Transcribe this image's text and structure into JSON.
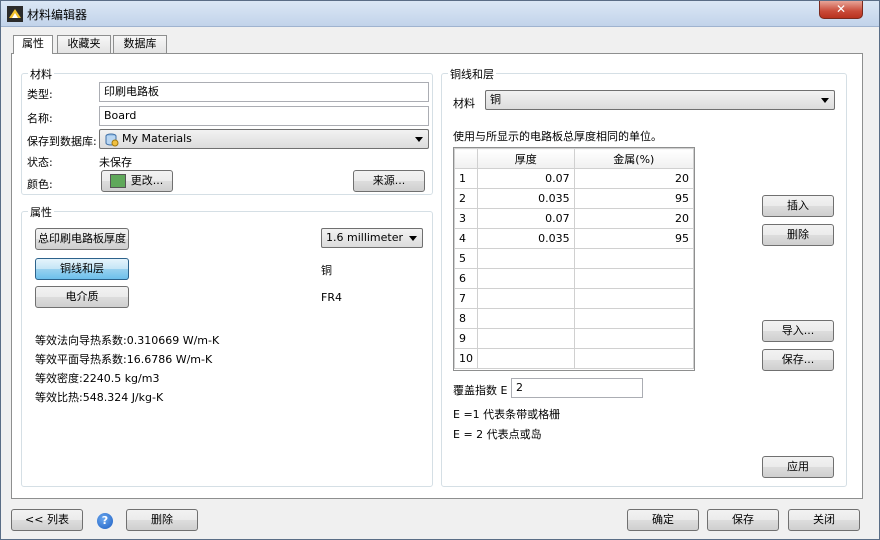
{
  "window": {
    "title": "材料编辑器",
    "close_label": "✕"
  },
  "tabs": [
    {
      "label": "属性",
      "active": true
    },
    {
      "label": "收藏夹",
      "active": false
    },
    {
      "label": "数据库",
      "active": false
    }
  ],
  "material": {
    "group_title": "材料",
    "type_label": "类型:",
    "type_value": "印刷电路板",
    "name_label": "名称:",
    "name_value": "Board",
    "save_label": "保存到数据库:",
    "save_value": "My Materials",
    "state_label": "状态:",
    "state_value": "未保存",
    "color_label": "颜色:",
    "color_swatch": "#5fa85a",
    "change_button": "更改...",
    "source_button": "来源..."
  },
  "properties": {
    "group_title": "属性",
    "thickness_button": "总印刷电路板厚度",
    "thickness_value": "1.6 millimeter",
    "copper_button": "铜线和层",
    "copper_value": "铜",
    "dielectric_button": "电介质",
    "dielectric_value": "FR4",
    "stats": [
      "等效法向导热系数:0.310669 W/m-K",
      "等效平面导热系数:16.6786 W/m-K",
      "等效密度:2240.5 kg/m3",
      "等效比热:548.324 J/kg-K"
    ]
  },
  "copper": {
    "group_title": "铜线和层",
    "material_label": "材料",
    "material_value": "铜",
    "hint": "使用与所显示的电路板总厚度相同的单位。",
    "columns": [
      "厚度",
      "金属(%)"
    ],
    "rows": [
      {
        "n": "1",
        "thickness": "0.07",
        "metal": "20"
      },
      {
        "n": "2",
        "thickness": "0.035",
        "metal": "95"
      },
      {
        "n": "3",
        "thickness": "0.07",
        "metal": "20"
      },
      {
        "n": "4",
        "thickness": "0.035",
        "metal": "95"
      },
      {
        "n": "5",
        "thickness": "",
        "metal": ""
      },
      {
        "n": "6",
        "thickness": "",
        "metal": ""
      },
      {
        "n": "7",
        "thickness": "",
        "metal": ""
      },
      {
        "n": "8",
        "thickness": "",
        "metal": ""
      },
      {
        "n": "9",
        "thickness": "",
        "metal": ""
      },
      {
        "n": "10",
        "thickness": "",
        "metal": ""
      }
    ],
    "insert_button": "插入",
    "delete_button": "删除",
    "import_button": "导入...",
    "save_button": "保存...",
    "coverage_label": "覆盖指数 E",
    "coverage_value": "2",
    "note1": "E =1 代表条带或格栅",
    "note2": "E = 2 代表点或岛",
    "apply_button": "应用"
  },
  "footer": {
    "list_button": "<< 列表",
    "help_icon": "?",
    "delete_button": "删除",
    "ok_button": "确定",
    "save_button": "保存",
    "close_button": "关闭"
  }
}
